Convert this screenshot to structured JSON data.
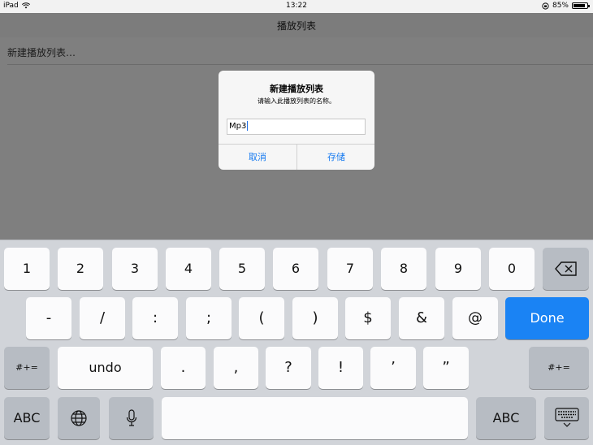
{
  "status": {
    "device": "iPad",
    "time": "13:22",
    "battery": "85%",
    "battery_fraction": 0.85
  },
  "nav": {
    "title": "播放列表"
  },
  "list": {
    "new_playlist_row": "新建播放列表…"
  },
  "alert": {
    "title": "新建播放列表",
    "message": "请输入此播放列表的名称。",
    "input_value": "Mp3",
    "cancel_label": "取消",
    "save_label": "存储"
  },
  "keyboard": {
    "row1": [
      "1",
      "2",
      "3",
      "4",
      "5",
      "6",
      "7",
      "8",
      "9",
      "0"
    ],
    "row2": [
      "-",
      "/",
      ":",
      ";",
      "(",
      ")",
      "$",
      "&",
      "@"
    ],
    "done_label": "Done",
    "row3_left": "#+=",
    "row3_undo": "undo",
    "row3": [
      ".",
      ",",
      "?",
      "!",
      "’",
      "”"
    ],
    "row3_right": "#+=",
    "abc_left": "ABC",
    "abc_right": "ABC"
  }
}
